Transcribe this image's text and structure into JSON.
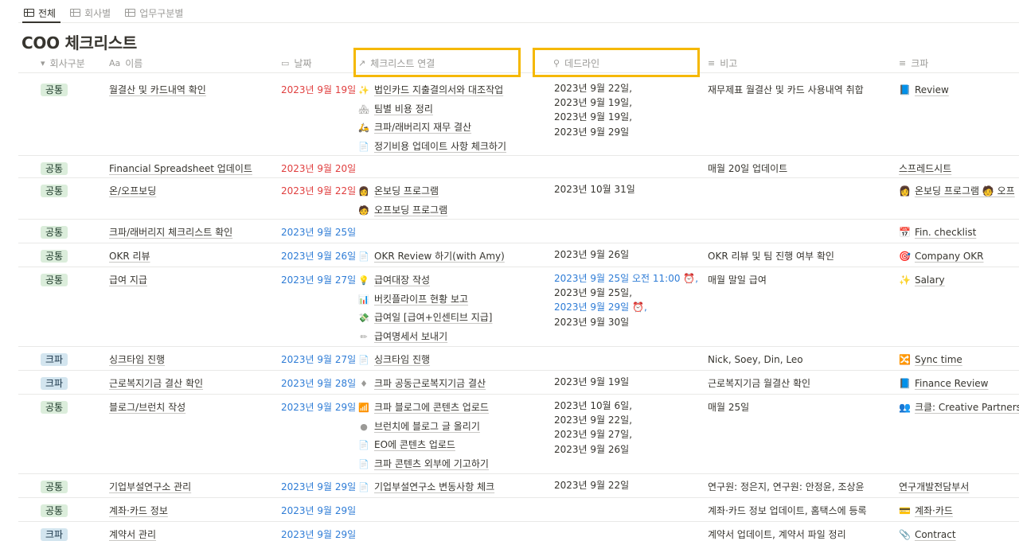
{
  "tabs": [
    {
      "label": "전체",
      "active": true
    },
    {
      "label": "회사별",
      "active": false
    },
    {
      "label": "업무구분별",
      "active": false
    }
  ],
  "title": "COO 체크리스트",
  "headers": {
    "company": "회사구분",
    "name": "이름",
    "date": "날짜",
    "checklist": "체크리스트 연결",
    "deadline": "데드라인",
    "note": "비고",
    "kpa": "크파"
  },
  "header_icons": {
    "company": "▾",
    "name": "Aa",
    "date": "▭",
    "checklist": "↗",
    "deadline": "⚲",
    "note": "≡",
    "kpa": "≡"
  },
  "accent": "#f5b800",
  "rows": [
    {
      "company": "공통",
      "name": "월결산 및 카드내역 확인",
      "date": "2023년 9월 19일",
      "date_color": "red",
      "checklist": [
        {
          "e": "✨",
          "t": "법인카드 지출결의서와 대조작업"
        },
        {
          "e": "🏘",
          "t": "팀별 비용 정리"
        },
        {
          "e": "🛵",
          "t": "크파/래버리지 재무 결산"
        },
        {
          "e": "📄",
          "t": "정기비용 업데이트 사항 체크하기"
        }
      ],
      "deadline": [
        {
          "t": "2023년 9월 22일,"
        },
        {
          "t": "2023년 9월 19일,"
        },
        {
          "t": "2023년 9월 19일,"
        },
        {
          "t": "2023년 9월 29일"
        }
      ],
      "note": "재무제표 월결산 및 카드 사용내역 취합",
      "kpa": "Review",
      "kpa_icon": "📘"
    },
    {
      "company": "공통",
      "name": "Financial Spreadsheet 업데이트",
      "date": "2023년 9월 20일",
      "date_color": "red",
      "checklist": [],
      "deadline": [],
      "note": "매월 20일 업데이트",
      "kpa": "스프레드시트",
      "kpa_icon": ""
    },
    {
      "company": "공통",
      "name": "온/오프보딩",
      "date": "2023년 9월 22일",
      "date_color": "red",
      "checklist": [
        {
          "e": "👩",
          "t": "온보딩 프로그램"
        },
        {
          "e": "🧑",
          "t": "오프보딩 프로그램"
        }
      ],
      "deadline": [
        {
          "t": "2023년 10월 31일"
        }
      ],
      "note": "",
      "kpa": "온보딩 프로그램 🧑 오프",
      "kpa_icon": "👩"
    },
    {
      "company": "공통",
      "name": "크파/래버리지 체크리스트 확인",
      "date": "2023년 9월 25일",
      "date_color": "blue",
      "checklist": [],
      "deadline": [],
      "note": "",
      "kpa": "Fin. checklist",
      "kpa_icon": "📅"
    },
    {
      "company": "공통",
      "name": "OKR 리뷰",
      "date": "2023년 9월 26일",
      "date_color": "blue",
      "checklist": [
        {
          "e": "📄",
          "t": "OKR Review 하기(with Amy)"
        }
      ],
      "deadline": [
        {
          "t": "2023년 9월 26일"
        }
      ],
      "note": "OKR 리뷰 및 팀 진행 여부 확인",
      "kpa": "Company OKR",
      "kpa_icon": "🎯"
    },
    {
      "company": "공통",
      "name": "급여 지급",
      "date": "2023년 9월 27일",
      "date_color": "blue",
      "checklist": [
        {
          "e": "💡",
          "t": "급여대장 작성"
        },
        {
          "e": "📊",
          "t": "버킷플라이프 현황 보고"
        },
        {
          "e": "💸",
          "t": "급여일 [급여+인센티브 지급]"
        },
        {
          "e": "✏",
          "t": "급여명세서 보내기"
        }
      ],
      "deadline": [
        {
          "t": "2023년 9월 25일 오전 11:00 ⏰,",
          "c": "blue"
        },
        {
          "t": "2023년 9월 25일,"
        },
        {
          "t": "2023년 9월 29일 ⏰,",
          "c": "blue"
        },
        {
          "t": "2023년 9월 30일"
        }
      ],
      "note": "매월 말일 급여",
      "kpa": "Salary",
      "kpa_icon": "✨"
    },
    {
      "company": "크파",
      "name": "싱크타임 진행",
      "date": "2023년 9월 27일",
      "date_color": "blue",
      "checklist": [
        {
          "e": "📄",
          "t": "싱크타임 진행"
        }
      ],
      "deadline": [],
      "note": "Nick, Soey, Din, Leo",
      "kpa": "Sync time",
      "kpa_icon": "🔀"
    },
    {
      "company": "크파",
      "name": "근로복지기금 결산 확인",
      "date": "2023년 9월 28일",
      "date_color": "blue",
      "checklist": [
        {
          "e": "♦",
          "t": "크파 공동근로복지기금 결산"
        }
      ],
      "deadline": [
        {
          "t": "2023년 9월 19일"
        }
      ],
      "note": "근로복지기금 월결산 확인",
      "kpa": "Finance Review",
      "kpa_icon": "📘"
    },
    {
      "company": "공통",
      "name": "블로그/브런치 작성",
      "date": "2023년 9월 29일",
      "date_color": "blue",
      "checklist": [
        {
          "e": "📶",
          "t": "크파 블로그에 콘텐츠 업로드"
        },
        {
          "e": "●",
          "t": "브런치에 블로그 글 올리기"
        },
        {
          "e": "📄",
          "t": "EO에 콘텐츠 업로드"
        },
        {
          "e": "📄",
          "t": "크파 콘텐츠 외부에 기고하기"
        }
      ],
      "deadline": [
        {
          "t": "2023년 10월 6일,"
        },
        {
          "t": "2023년 9월 22일,"
        },
        {
          "t": "2023년 9월 27일,"
        },
        {
          "t": "2023년 9월 26일"
        }
      ],
      "note": "매월 25일",
      "kpa": "크클: Creative Partners W",
      "kpa_icon": "👥"
    },
    {
      "company": "공통",
      "name": "기업부설연구소 관리",
      "date": "2023년 9월 29일",
      "date_color": "blue",
      "checklist": [
        {
          "e": "📄",
          "t": "기업부설연구소 변동사항 체크"
        }
      ],
      "deadline": [
        {
          "t": "2023년 9월 22일"
        }
      ],
      "note": "연구원: 정은지, 연구원: 안정윤, 조상윤",
      "kpa": "연구개발전담부서",
      "kpa_icon": ""
    },
    {
      "company": "공통",
      "name": "계좌·카드 정보",
      "date": "2023년 9월 29일",
      "date_color": "blue",
      "checklist": [],
      "deadline": [],
      "note": "계좌·카드 정보 업데이트, 홈택스에 등록",
      "kpa": "계좌·카드",
      "kpa_icon": "💳"
    },
    {
      "company": "크파",
      "name": "계약서 관리",
      "date": "2023년 9월 29일",
      "date_color": "blue",
      "checklist": [],
      "deadline": [],
      "note": "계약서 업데이트, 계약서 파일 정리",
      "kpa": "Contract",
      "kpa_icon": "📎"
    }
  ]
}
